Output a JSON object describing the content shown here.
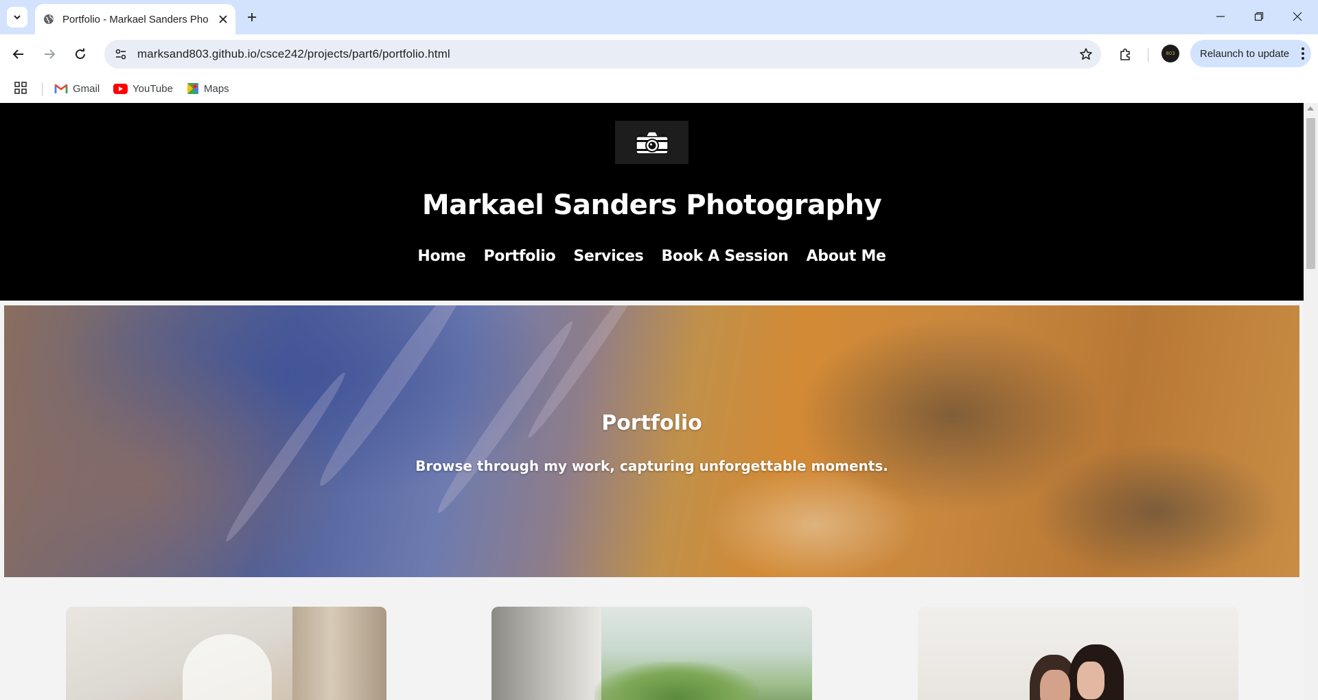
{
  "browser": {
    "tab": {
      "title": "Portfolio - Markael Sanders Photography"
    },
    "url": "marksand803.github.io/csce242/projects/part6/portfolio.html",
    "relaunch_label": "Relaunch to update",
    "profile_text": "803",
    "bookmarks": [
      {
        "label": "Gmail",
        "icon": "gmail-icon"
      },
      {
        "label": "YouTube",
        "icon": "youtube-icon"
      },
      {
        "label": "Maps",
        "icon": "maps-icon"
      }
    ]
  },
  "site": {
    "logo_icon": "camera-icon",
    "title": "Markael Sanders Photography",
    "nav": [
      "Home",
      "Portfolio",
      "Services",
      "Book A Session",
      "About Me"
    ]
  },
  "hero": {
    "title": "Portfolio",
    "subtitle": "Browse through my work, capturing unforgettable moments."
  },
  "gallery": {
    "cards": [
      "wedding-veil-photo",
      "graduation-outdoor-photo",
      "couple-kiss-photo"
    ]
  },
  "colors": {
    "tabstrip": "#d3e3fd",
    "omnibox": "#e9eef6",
    "header_bg": "#000000",
    "page_bg": "#f3f3f3"
  }
}
